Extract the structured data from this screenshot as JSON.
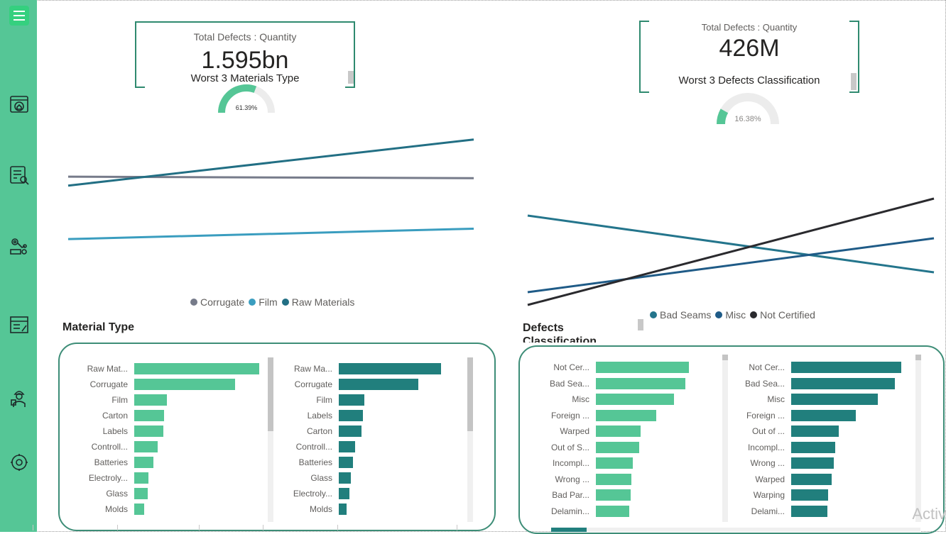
{
  "colors": {
    "sidebar": "#55c696",
    "accent": "#55c696",
    "teal_dark": "#217f7d",
    "corrugate": "#767b8a",
    "film": "#3a9dbf",
    "raw_materials": "#226f84",
    "bad_seams": "#24758c",
    "misc": "#1f5b87",
    "not_certified": "#2a2a2e"
  },
  "sidebar": {
    "icons": [
      "menu-icon",
      "dashboard-home-icon",
      "report-search-icon",
      "factory-robot-icon",
      "document-list-icon",
      "worker-icon",
      "settings-icon"
    ]
  },
  "kpi_left": {
    "title": "Total Defects : Quantity",
    "value": "1.595bn",
    "subtitle": "Worst 3 Materials Type",
    "gauge_label": "61.39%",
    "gauge_value": 0.6139
  },
  "kpi_right": {
    "title": "Total Defects : Quantity",
    "value": "426M",
    "subtitle": "Worst 3 Defects Classification",
    "gauge_label": "16.38%",
    "gauge_value": 0.1638
  },
  "chart_data": [
    {
      "type": "line",
      "x": [
        0,
        1
      ],
      "series": [
        {
          "name": "Corrugate",
          "values": [
            0.72,
            0.71
          ]
        },
        {
          "name": "Film",
          "values": [
            0.3,
            0.37
          ]
        },
        {
          "name": "Raw Materials",
          "values": [
            0.66,
            0.97
          ]
        }
      ],
      "ylim": [
        0,
        1.05
      ]
    },
    {
      "type": "line",
      "x": [
        0,
        1
      ],
      "series": [
        {
          "name": "Bad Seams",
          "values": [
            0.63,
            0.23
          ]
        },
        {
          "name": "Misc",
          "values": [
            0.09,
            0.47
          ]
        },
        {
          "name": "Not Certified",
          "values": [
            0.0,
            0.75
          ]
        }
      ],
      "ylim": [
        -0.05,
        1
      ]
    },
    {
      "type": "bar",
      "categories": [
        "Raw Mat...",
        "Corrugate",
        "Film",
        "Carton",
        "Labels",
        "Controll...",
        "Batteries",
        "Electroly...",
        "Glass",
        "Molds"
      ],
      "values": [
        176,
        142,
        46,
        42,
        41,
        33,
        27,
        20,
        19,
        14
      ],
      "xlim": [
        0,
        180
      ]
    },
    {
      "type": "bar",
      "categories": [
        "Raw Ma...",
        "Corrugate",
        "Film",
        "Labels",
        "Carton",
        "Controll...",
        "Batteries",
        "Glass",
        "Electroly...",
        "Molds"
      ],
      "values": [
        144,
        112,
        36,
        34,
        32,
        23,
        20,
        17,
        15,
        11
      ],
      "xlim": [
        0,
        160
      ]
    },
    {
      "type": "bar",
      "categories": [
        "Not Cer...",
        "Bad Sea...",
        "Misc",
        "Foreign ...",
        "Warped",
        "Out of S...",
        "Incompl...",
        "Wrong ...",
        "Bad Par...",
        "Delamin..."
      ],
      "values": [
        131,
        126,
        110,
        85,
        63,
        61,
        52,
        50,
        49,
        47
      ],
      "xlim": [
        0,
        180
      ]
    },
    {
      "type": "bar",
      "categories": [
        "Not Cer...",
        "Bad Sea...",
        "Misc",
        "Foreign ...",
        "Out of ...",
        "Incompl...",
        "Wrong ...",
        "Warped",
        "Warping",
        "Delami..."
      ],
      "values": [
        155,
        146,
        122,
        91,
        67,
        62,
        60,
        57,
        52,
        51
      ],
      "xlim": [
        0,
        170
      ]
    }
  ],
  "legend_left": [
    "Corrugate",
    "Film",
    "Raw Materials"
  ],
  "legend_right": [
    "Bad Seams",
    "Misc",
    "Not Certified"
  ],
  "section_left": "Material Type",
  "section_right": "Defects",
  "section_right_cut": "Classification",
  "watermark": "Activ"
}
